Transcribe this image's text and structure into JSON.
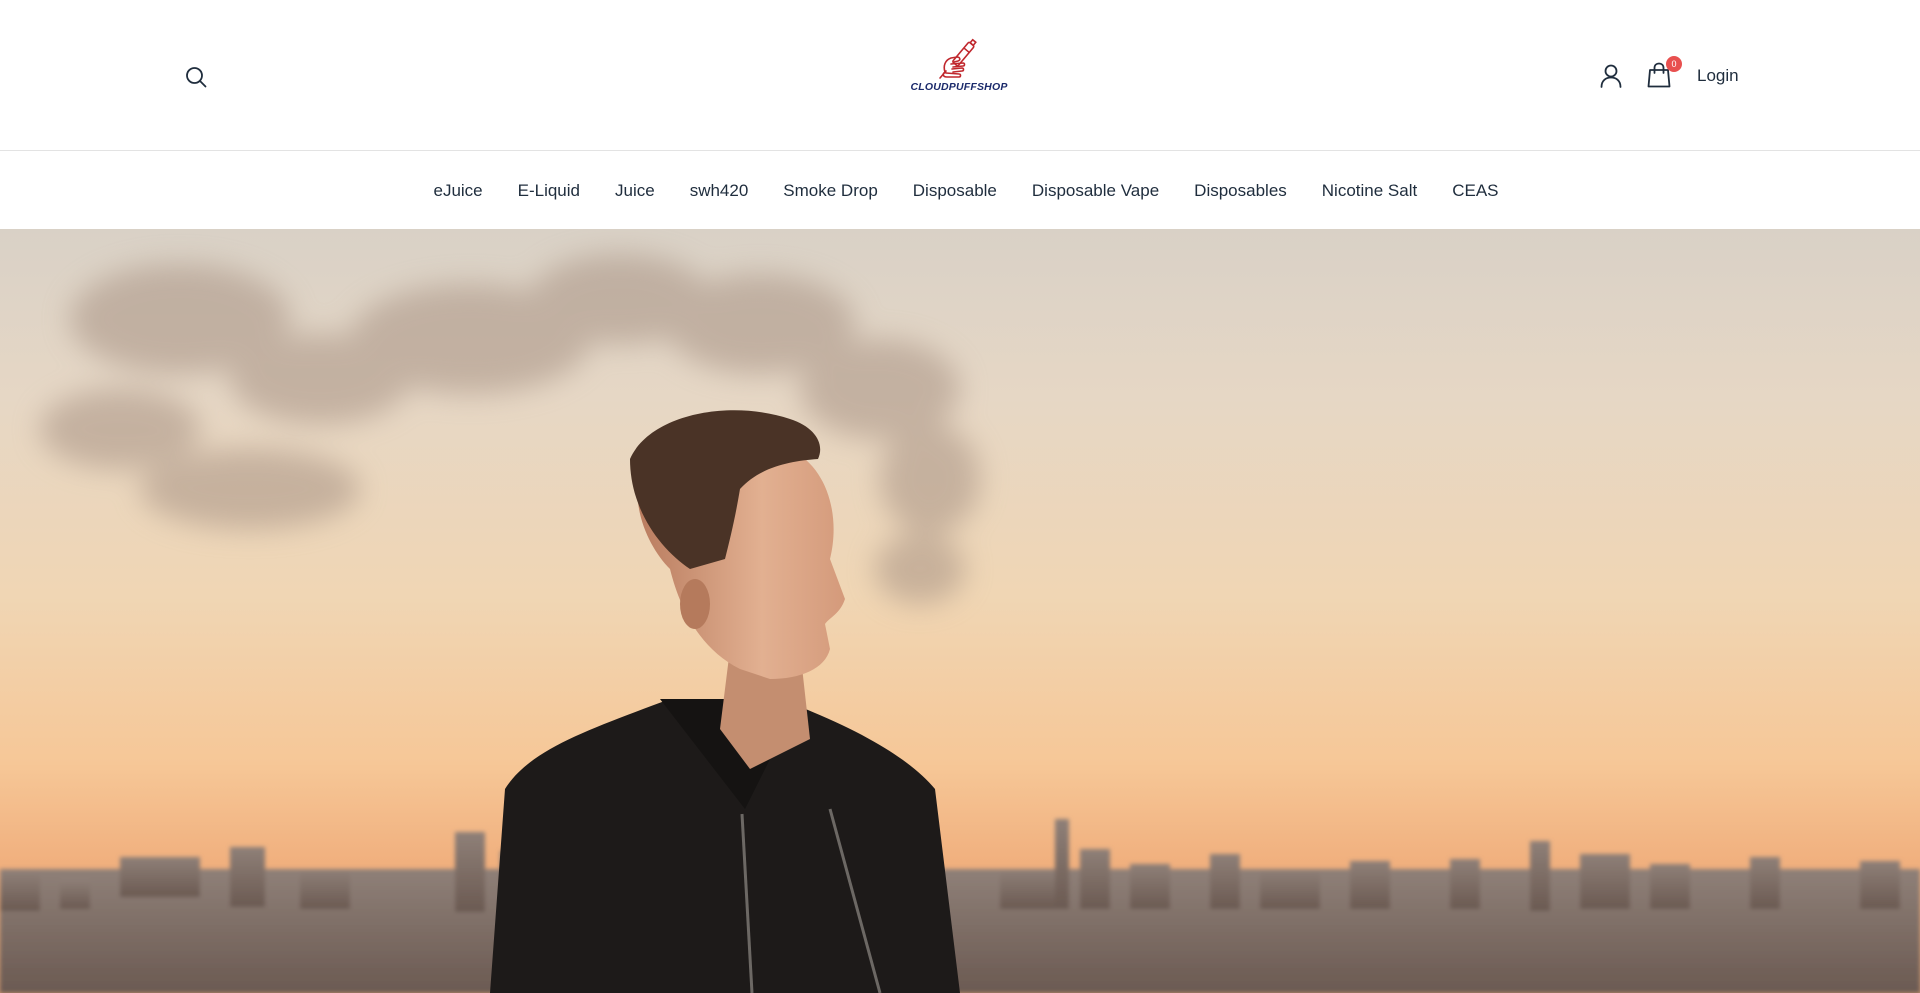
{
  "header": {
    "logo_text": "CLOUDPUFFSHOP",
    "login_label": "Login",
    "cart_count": "0",
    "icons": {
      "search": "search-icon",
      "account": "user-icon",
      "cart": "shopping-bag-icon",
      "logo": "hand-vape-logo"
    },
    "colors": {
      "logo_red": "#c0272d",
      "logo_blue": "#1b2a6b",
      "badge": "#e8504f",
      "text": "#1f2d3d"
    }
  },
  "nav": {
    "items": [
      {
        "label": "eJuice"
      },
      {
        "label": "E-Liquid"
      },
      {
        "label": "Juice"
      },
      {
        "label": "swh420"
      },
      {
        "label": "Smoke Drop"
      },
      {
        "label": "Disposable"
      },
      {
        "label": "Disposable Vape"
      },
      {
        "label": "Disposables"
      },
      {
        "label": "Nicotine Salt"
      },
      {
        "label": "CEAS"
      }
    ]
  },
  "hero": {
    "image": "man-exhaling-vapor-at-sunset-over-city-skyline"
  }
}
